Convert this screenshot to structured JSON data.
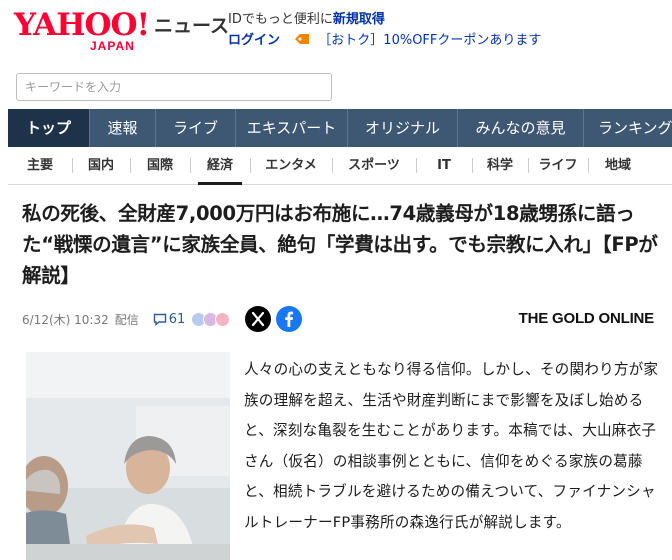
{
  "header": {
    "logo_main": "YAHOO!",
    "logo_sub": "JAPAN",
    "service": "ニュース",
    "promo_prefix": "IDでもっと便利に",
    "promo_link": "新規取得",
    "login": "ログイン",
    "coupon": "［おトク］10%OFFクーポンあります"
  },
  "search": {
    "placeholder": "キーワードを入力"
  },
  "main_nav": [
    {
      "label": "トップ",
      "active": true
    },
    {
      "label": "速報"
    },
    {
      "label": "ライブ"
    },
    {
      "label": "エキスパート"
    },
    {
      "label": "オリジナル"
    },
    {
      "label": "みんなの意見"
    },
    {
      "label": "ランキング"
    }
  ],
  "sub_nav": [
    {
      "label": "主要"
    },
    {
      "label": "国内"
    },
    {
      "label": "国際"
    },
    {
      "label": "経済",
      "active": true
    },
    {
      "label": "エンタメ"
    },
    {
      "label": "スポーツ"
    },
    {
      "label": "IT"
    },
    {
      "label": "科学"
    },
    {
      "label": "ライフ"
    },
    {
      "label": "地域"
    }
  ],
  "article": {
    "title": "私の死後、全財産7,000万円はお布施に…74歳義母が18歳甥孫に語った“戦慄の遺言”に家族全員、絶句「学費は出す。でも宗教に入れ」【FPが解説】",
    "date": "6/12(木) 10:32",
    "delivered": "配信",
    "comment_count": "61",
    "publisher": "THE GOLD ONLINE",
    "lead": "人々の心の支えともなり得る信仰。しかし、その関わり方が家族の理解を超え、生活や財産判断にまで影響を及ぼし始めると、深刻な亀裂を生むことがあります。本稿では、大山麻衣子さん（仮名）の相談事例とともに、信仰をめぐる家族の葛藤と、相続トラブルを避けるための備えついて、ファイナンシャルトレーナーFP事務所の森逸行氏が解説します。"
  },
  "colors": {
    "brand": "#ff0033",
    "nav_bg": "#3e5873",
    "nav_active": "#1e3249",
    "link": "#0033aa"
  },
  "icons": [
    "tag-icon",
    "comment-icon",
    "x-icon",
    "facebook-icon"
  ]
}
